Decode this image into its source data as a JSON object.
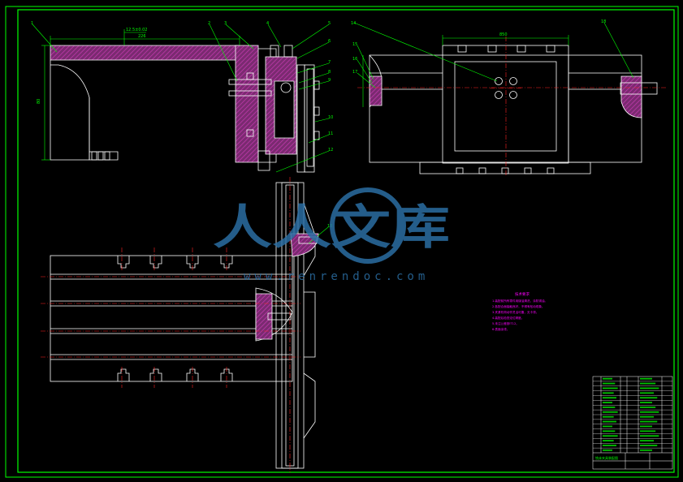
{
  "colors": {
    "background": "#000000",
    "frame": "#00ff00",
    "outline": "#ffffff",
    "hatch": "#b0339a",
    "centerline": "#ff2020",
    "leader": "#00ff00",
    "tech_note": "#ff00ff",
    "watermark": "#2b6ea3"
  },
  "watermark": {
    "brand": "人人文库",
    "url": "www.renrendoc.com"
  },
  "dims": {
    "length_top": "226",
    "height_left": "80",
    "width_right": "850",
    "offset": "12.5±0.02"
  },
  "balloons": {
    "top_view": [
      "1",
      "2",
      "3",
      "4",
      "5",
      "6",
      "7",
      "8",
      "9",
      "10",
      "11",
      "12"
    ],
    "side_view": [
      "14",
      "15",
      "16",
      "17",
      "18"
    ],
    "section": [
      "13"
    ]
  },
  "tech_requirements": {
    "title": "技术要求",
    "lines": [
      "1.装配前所有零件用煤油清洗，涂防锈油。",
      "2.各配合面接触良好，不得有松动现象。",
      "3.夹紧机构动作灵活可靠，无卡滞。",
      "4.装配后检查定位精度。",
      "5.未注公差按IT12。",
      "6.表面涂漆。"
    ]
  },
  "title_block": {
    "drawing_name": "铣床夹具装配图"
  }
}
